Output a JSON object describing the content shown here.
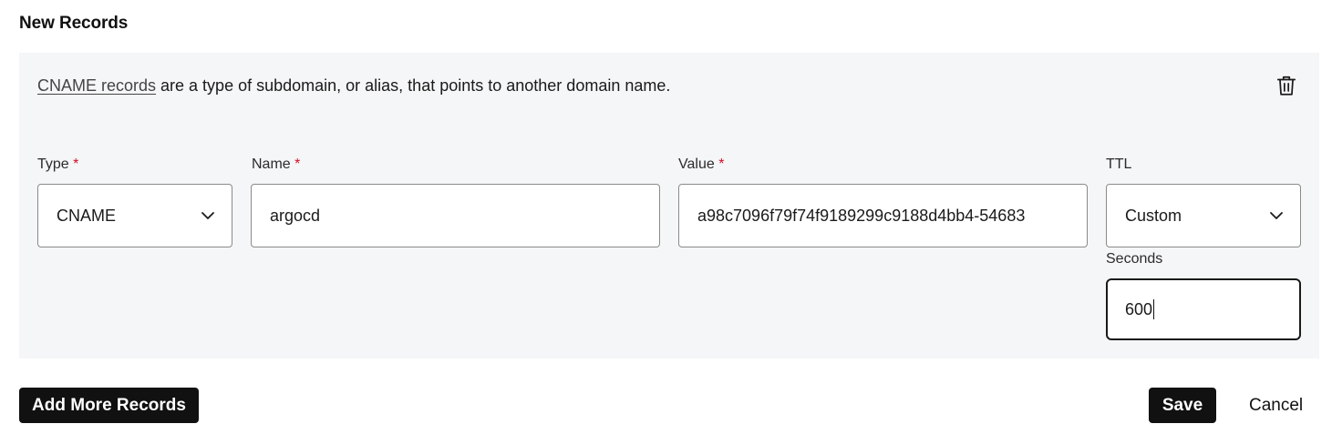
{
  "section": {
    "title": "New Records"
  },
  "record": {
    "description": {
      "link_text": "CNAME records",
      "text": " are a type of subdomain, or alias, that points to another domain name."
    },
    "delete_icon": "trash-icon",
    "fields": {
      "type": {
        "label": "Type",
        "required_mark": "*",
        "value": "CNAME"
      },
      "name": {
        "label": "Name",
        "required_mark": "*",
        "value": "argocd"
      },
      "value": {
        "label": "Value",
        "required_mark": "*",
        "value": "a98c7096f79f74f9189299c9188d4bb4-54683"
      },
      "ttl": {
        "label": "TTL",
        "value": "Custom"
      },
      "seconds": {
        "label": "Seconds",
        "value": "600"
      }
    }
  },
  "actions": {
    "add_more": "Add More Records",
    "save": "Save",
    "cancel": "Cancel"
  },
  "colors": {
    "panel_bg": "#f5f6f7",
    "required": "#d0102a",
    "button_dark": "#111111"
  }
}
